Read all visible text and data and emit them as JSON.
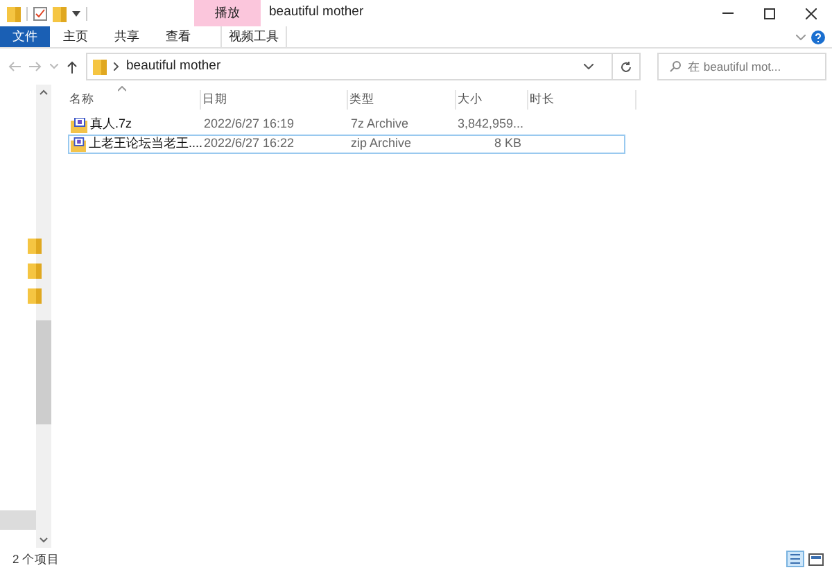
{
  "window": {
    "title": "beautiful mother"
  },
  "ribbon": {
    "context_group": "播放",
    "tabs": [
      {
        "label": "文件",
        "selected": true,
        "kind": "file"
      },
      {
        "label": "主页",
        "selected": false,
        "kind": "tab"
      },
      {
        "label": "共享",
        "selected": false,
        "kind": "tab"
      },
      {
        "label": "查看",
        "selected": false,
        "kind": "tab"
      },
      {
        "label": "视频工具",
        "selected": false,
        "kind": "context"
      }
    ]
  },
  "address": {
    "path": "beautiful mother",
    "search_placeholder": "在 beautiful mot..."
  },
  "table": {
    "columns": [
      {
        "label": "名称",
        "sorted": true
      },
      {
        "label": "日期",
        "sorted": false
      },
      {
        "label": "类型",
        "sorted": false
      },
      {
        "label": "大小",
        "sorted": false
      },
      {
        "label": "时长",
        "sorted": false
      }
    ],
    "rows": [
      {
        "name": "真人.7z",
        "date": "2022/6/27 16:19",
        "type": "7z Archive",
        "size": "3,842,959...",
        "selected": false
      },
      {
        "name": "上老王论坛当老王....",
        "date": "2022/6/27 16:22",
        "type": "zip Archive",
        "size": "8 KB",
        "selected": true
      }
    ]
  },
  "status_bar": {
    "count": "2 个项目"
  }
}
